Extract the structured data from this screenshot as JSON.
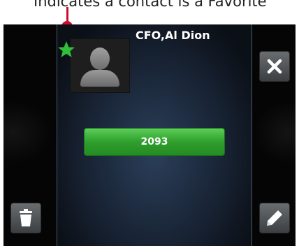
{
  "annotation": {
    "text": "Indicates a contact is a Favorite",
    "accent_color": "#c8102e"
  },
  "contact": {
    "name": "CFO,Al Dion",
    "number": "2093",
    "is_favorite": true,
    "avatar_icon": "person-silhouette-icon",
    "favorite_icon": "star-icon",
    "favorite_color": "#2fbf3a"
  },
  "actions": {
    "close_icon": "close-icon",
    "edit_icon": "pencil-icon",
    "delete_icon": "trash-icon"
  },
  "colors": {
    "number_button": "#2f9f2d",
    "panel_divider": "#4a5b6e"
  }
}
